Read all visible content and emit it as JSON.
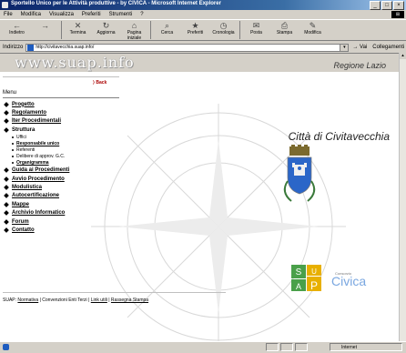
{
  "window": {
    "title": "Sportello Unico per le Attività produttive - by CIVICA - Microsoft Internet Explorer"
  },
  "menubar": [
    "File",
    "Modifica",
    "Visualizza",
    "Preferiti",
    "Strumenti",
    "?"
  ],
  "toolbar": [
    {
      "label": "Indietro",
      "icon": "back-arrow-icon",
      "glyph": "←"
    },
    {
      "label": "",
      "icon": "forward-arrow-icon",
      "glyph": "→"
    },
    {
      "label": "Termina",
      "icon": "stop-icon",
      "glyph": "✕"
    },
    {
      "label": "Aggiorna",
      "icon": "refresh-icon",
      "glyph": "↻"
    },
    {
      "label": "Pagina iniziale",
      "icon": "home-icon",
      "glyph": "⌂"
    },
    {
      "label": "Cerca",
      "icon": "search-icon",
      "glyph": "⌕"
    },
    {
      "label": "Preferiti",
      "icon": "favorites-icon",
      "glyph": "★"
    },
    {
      "label": "Cronologia",
      "icon": "history-icon",
      "glyph": "◷"
    },
    {
      "label": "Posta",
      "icon": "mail-icon",
      "glyph": "✉"
    },
    {
      "label": "Stampa",
      "icon": "print-icon",
      "glyph": "⎙"
    },
    {
      "label": "Modifica",
      "icon": "edit-icon",
      "glyph": "✎"
    }
  ],
  "address": {
    "label": "Indirizzo",
    "value": "http://civitavecchia.suap.info/",
    "go": "Vai",
    "links": "Collegamenti"
  },
  "page": {
    "site_logo": "www.suap.info",
    "regione": "Regione Lazio",
    "citta": "Città di Civitavecchia",
    "back": "Back",
    "menu_heading": "Menu",
    "menu_before": [
      {
        "label": "Progetto",
        "link": true
      },
      {
        "label": "Regolamento",
        "link": true
      },
      {
        "label": "Iter Procedimentali",
        "link": true
      },
      {
        "label": "Struttura",
        "link": false
      }
    ],
    "struttura_sub": [
      {
        "label": "Uffici",
        "link": false
      },
      {
        "label": "Responsabile unico",
        "link": true
      },
      {
        "label": "Referenti",
        "link": false
      },
      {
        "label": "Delibere di approv. G.C.",
        "link": false
      },
      {
        "label": "Organigramma",
        "link": true
      }
    ],
    "menu_after": [
      {
        "label": "Guida ai Procedimenti",
        "link": true
      },
      {
        "label": "Avvio Procedimento",
        "link": true
      },
      {
        "label": "Modulistica",
        "link": true
      },
      {
        "label": "Autocertificazione",
        "link": true
      },
      {
        "label": "Mappe",
        "link": true
      },
      {
        "label": "Archivio Informatico",
        "link": true
      },
      {
        "label": "Forum",
        "link": true
      },
      {
        "label": "Contatto",
        "link": true
      }
    ],
    "footer": {
      "prefix": "SUAP:",
      "normativa": "Normativa",
      "sep1": "| Convenzioni Enti Terzi |",
      "link_utili": "Link utili",
      "sep2": "|",
      "rassegna": "Rassegna Stampa"
    },
    "civica_small": "Consorzio",
    "civica": "Civica",
    "logo_letters": [
      "S",
      "U",
      "A",
      "P"
    ]
  },
  "status": {
    "zone": "Internet"
  },
  "colors": {
    "titlebar": "#0a246a",
    "logo_green": "#4aa04a",
    "logo_yellow": "#e8b000",
    "civica_blue": "#7aa7e0"
  }
}
